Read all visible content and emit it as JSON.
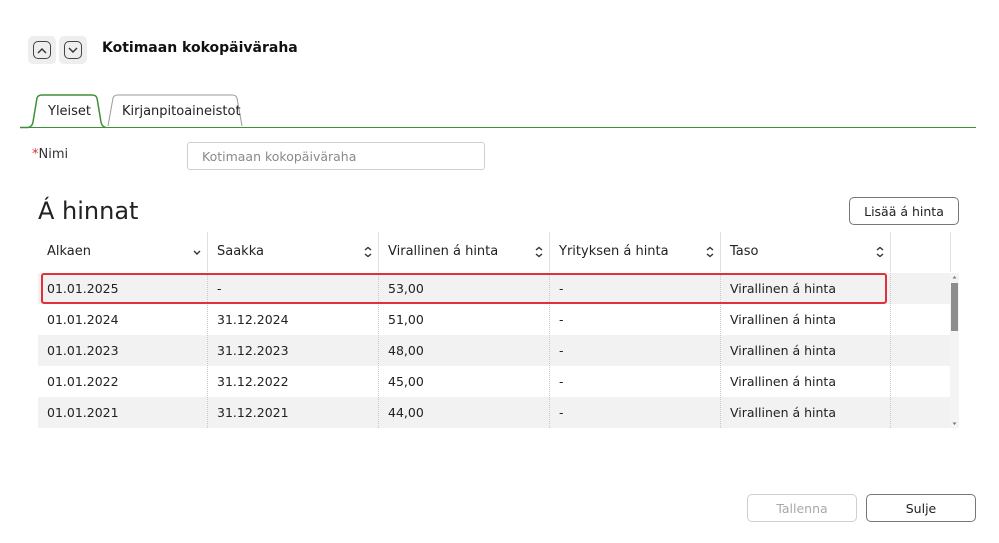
{
  "header": {
    "title": "Kotimaan kokopäiväraha",
    "nav_up_icon": "chevron-up-icon",
    "nav_down_icon": "chevron-down-icon"
  },
  "tabs": [
    {
      "label": "Yleiset",
      "active": true
    },
    {
      "label": "Kirjanpitoaineistot",
      "active": false
    }
  ],
  "colors": {
    "tab_accent": "#3f8f3a",
    "required": "#d9362e",
    "highlight": "#e1313a",
    "row_alt": "#f2f2f2"
  },
  "form": {
    "name_required_mark": "*",
    "name_label": "Nimi",
    "name_placeholder": "Kotimaan kokopäiväraha"
  },
  "section": {
    "title": "Á hinnat",
    "add_button": "Lisää á hinta"
  },
  "table": {
    "columns": [
      {
        "label": "Alkaen",
        "sort": "desc"
      },
      {
        "label": "Saakka",
        "sort": "both"
      },
      {
        "label": "Virallinen á hinta",
        "sort": "both"
      },
      {
        "label": "Yrityksen á hinta",
        "sort": "both"
      },
      {
        "label": "Taso",
        "sort": "both"
      }
    ],
    "rows": [
      [
        "01.01.2025",
        "-",
        "53,00",
        "-",
        "Virallinen á hinta"
      ],
      [
        "01.01.2024",
        "31.12.2024",
        "51,00",
        "-",
        "Virallinen á hinta"
      ],
      [
        "01.01.2023",
        "31.12.2023",
        "48,00",
        "-",
        "Virallinen á hinta"
      ],
      [
        "01.01.2022",
        "31.12.2022",
        "45,00",
        "-",
        "Virallinen á hinta"
      ],
      [
        "01.01.2021",
        "31.12.2021",
        "44,00",
        "-",
        "Virallinen á hinta"
      ]
    ],
    "highlighted_row": 0
  },
  "footer": {
    "save_label": "Tallenna",
    "save_enabled": false,
    "close_label": "Sulje"
  }
}
